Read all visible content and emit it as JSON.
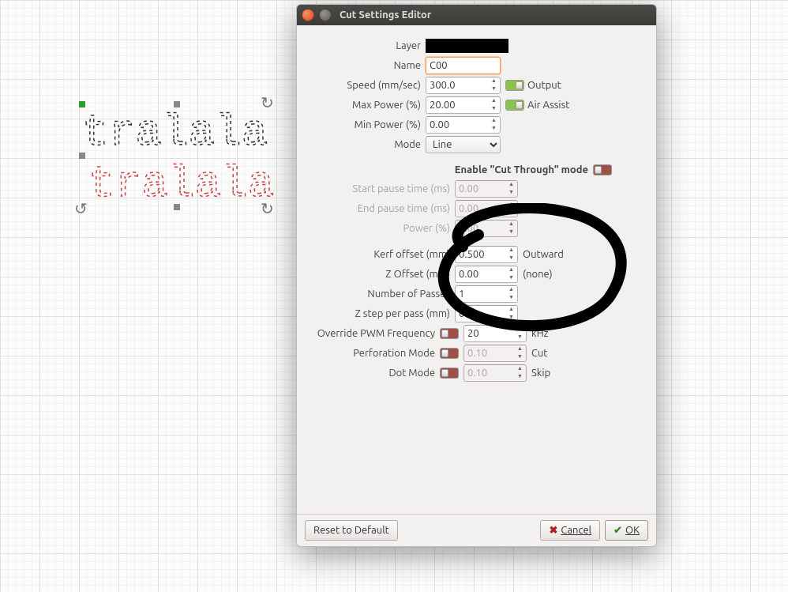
{
  "canvas": {
    "text_a": "tralala",
    "text_b": "tralala"
  },
  "dialog_title": "Cut Settings Editor",
  "form": {
    "layer_label": "Layer",
    "layer_color": "#000000",
    "name_label": "Name",
    "name_value": "C00",
    "speed_label": "Speed (mm/sec)",
    "speed_value": "300.0",
    "output_label": "Output",
    "output_on": true,
    "maxpower_label": "Max Power (%)",
    "maxpower_value": "20.00",
    "airassist_label": "Air Assist",
    "airassist_on": true,
    "minpower_label": "Min Power (%)",
    "minpower_value": "0.00",
    "mode_label": "Mode",
    "mode_value": "Line",
    "cutthrough_header": "Enable \"Cut Through\" mode",
    "cutthrough_on": false,
    "start_pause_label": "Start pause time (ms)",
    "start_pause_value": "0.00",
    "end_pause_label": "End pause time (ms)",
    "end_pause_value": "0.00",
    "ct_power_label": "Power (%)",
    "ct_power_value": "0.00",
    "kerf_label": "Kerf offset (mm)",
    "kerf_value": "0.500",
    "kerf_dir": "Outward",
    "zoff_label": "Z Offset (mm)",
    "zoff_value": "0.00",
    "zoff_note": "(none)",
    "passes_label": "Number of Passes",
    "passes_value": "1",
    "zstep_label": "Z step per pass (mm)",
    "zstep_value": "0.00",
    "pwm_label": "Override PWM Frequency",
    "pwm_on": false,
    "pwm_value": "20",
    "pwm_unit": "kHz",
    "perf_label": "Perforation Mode",
    "perf_on": false,
    "perf_value": "0.10",
    "perf_unit": "Cut",
    "dot_label": "Dot Mode",
    "dot_on": false,
    "dot_value": "0.10",
    "dot_unit": "Skip"
  },
  "buttons": {
    "reset": "Reset to Default",
    "cancel": "Cancel",
    "ok": "OK"
  }
}
